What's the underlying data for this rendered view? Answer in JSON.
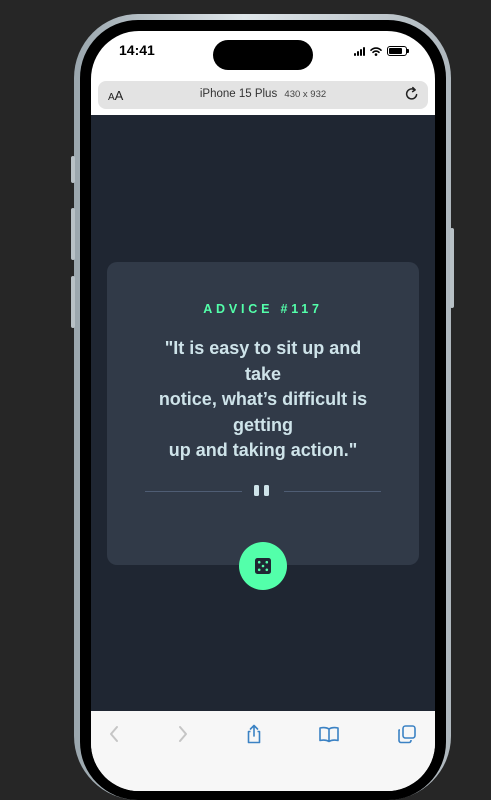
{
  "status_bar": {
    "time": "14:41"
  },
  "browser": {
    "aa_small": "A",
    "aa_large": "A",
    "device_name": "iPhone 15 Plus",
    "device_size": "430 x 932"
  },
  "advice": {
    "label": "ADVICE #117",
    "quote_lines": [
      "\"It is easy to sit up and",
      "take",
      "notice, what’s difficult is",
      "getting",
      "up and taking action.\""
    ]
  },
  "icons": {
    "reload": "reload-icon",
    "divider": "pause-icon",
    "dice": "dice-icon",
    "back": "chevron-left-icon",
    "forward": "chevron-right-icon",
    "share": "share-icon",
    "bookmarks": "book-icon",
    "tabs": "tabs-icon"
  },
  "colors": {
    "page_background": "#1f2632",
    "card_background": "#313a48",
    "accent": "#53ffaa",
    "quote_text": "#cee3e9",
    "divider": "#4f5d74",
    "toolbar_icon": "#3b82c4"
  }
}
